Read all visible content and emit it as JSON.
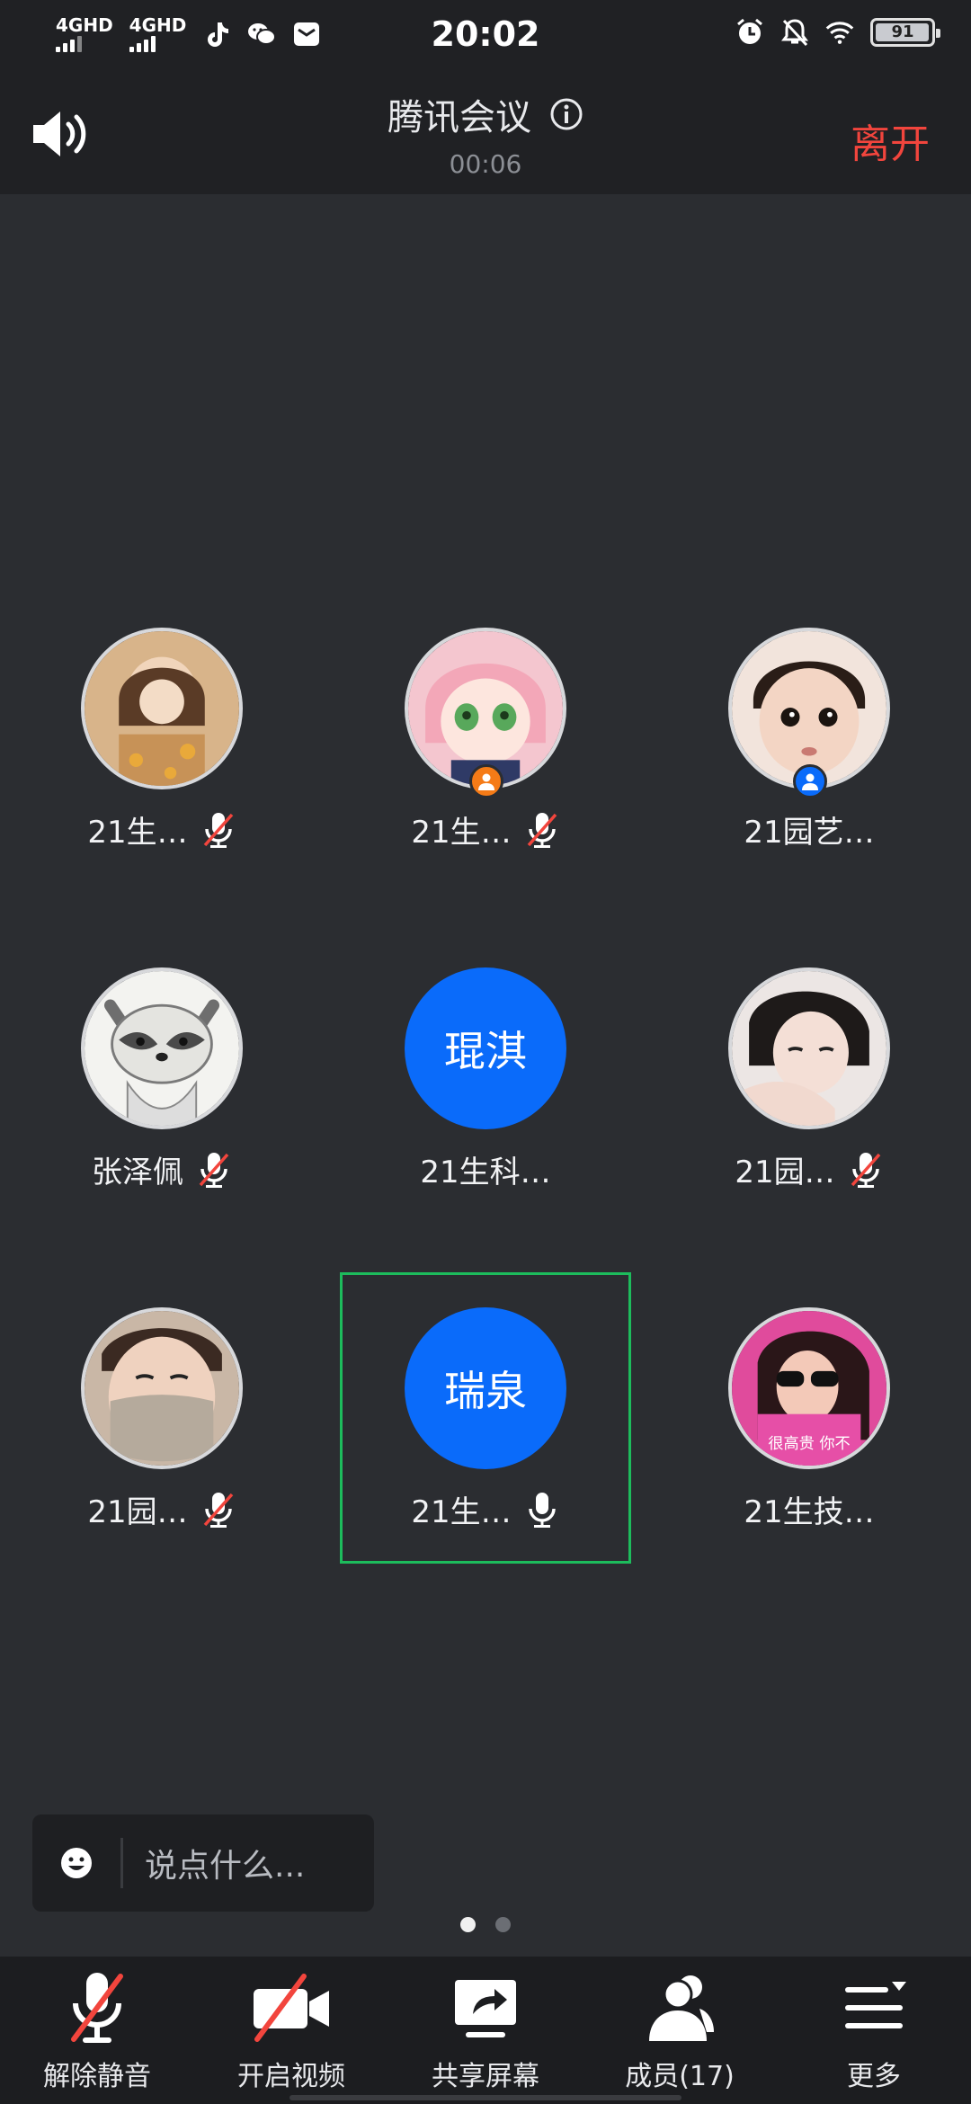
{
  "status_bar": {
    "time": "20:02",
    "sim1": "4GHD",
    "sim2": "4GHD",
    "battery": "91"
  },
  "header": {
    "title": "腾讯会议",
    "timer": "00:06",
    "leave_label": "离开"
  },
  "participants": [
    {
      "name": "21生…",
      "muted": true,
      "avatar": "photo-girl-warm"
    },
    {
      "name": "21生…",
      "muted": true,
      "avatar": "photo-anime-pink",
      "role": "host"
    },
    {
      "name": "21园艺…",
      "muted": false,
      "avatar": "photo-child",
      "role": "cohost"
    },
    {
      "name": "张泽佩",
      "muted": true,
      "avatar": "photo-raccoon"
    },
    {
      "name": "21生科…",
      "muted": false,
      "avatar": "text",
      "avatar_text": "琨淇"
    },
    {
      "name": "21园…",
      "muted": true,
      "avatar": "photo-girl-dark"
    },
    {
      "name": "21园…",
      "muted": true,
      "avatar": "photo-mask"
    },
    {
      "name": "21生…",
      "muted": false,
      "mic_on": true,
      "avatar": "text",
      "avatar_text": "瑞泉",
      "active": true
    },
    {
      "name": "21生技…",
      "muted": false,
      "avatar": "photo-pink-girl",
      "avatar_caption": "很高贵 你不"
    }
  ],
  "chat": {
    "placeholder": "说点什么..."
  },
  "pager": {
    "pages": 2,
    "current": 1
  },
  "toolbar": {
    "unmute_label": "解除静音",
    "video_label": "开启视频",
    "share_label": "共享屏幕",
    "members_label": "成员(17)",
    "more_label": "更多"
  },
  "colors": {
    "accent_blue": "#0a6bfa",
    "leave_red": "#f2453d",
    "active_green": "#1dbc5c",
    "host_orange": "#f57b17",
    "cohost_blue": "#0a6bfa",
    "background": "#2b2d31"
  }
}
